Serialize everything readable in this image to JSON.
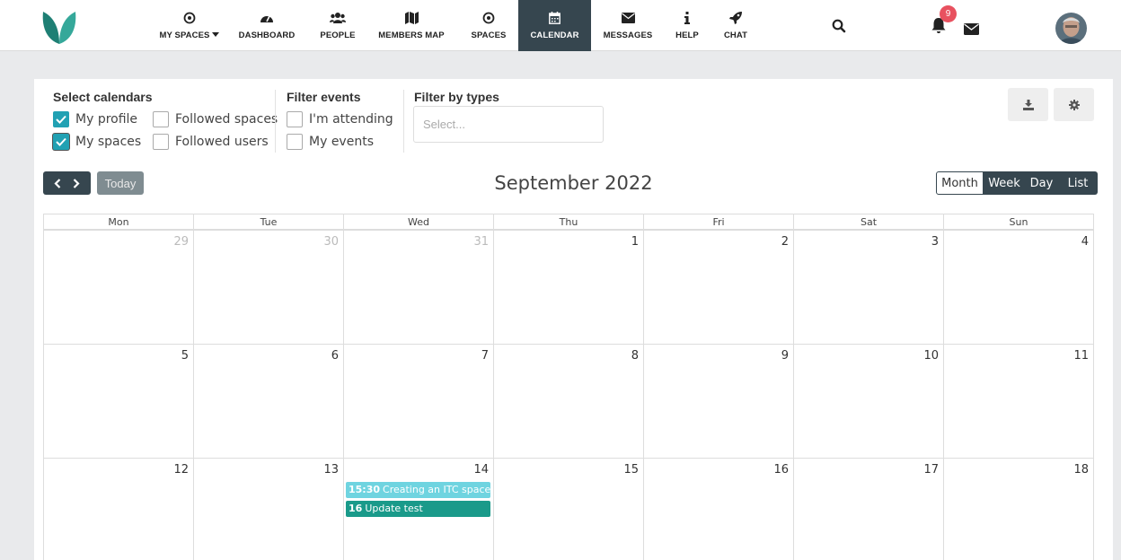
{
  "nav": {
    "items": [
      {
        "label": "MY SPACES",
        "icon": "dot-circle-icon"
      },
      {
        "label": "DASHBOARD",
        "icon": "tachometer-icon"
      },
      {
        "label": "PEOPLE",
        "icon": "users-icon"
      },
      {
        "label": "MEMBERS MAP",
        "icon": "map-icon"
      },
      {
        "label": "SPACES",
        "icon": "dot-circle-icon"
      },
      {
        "label": "CALENDAR",
        "icon": "calendar-icon"
      },
      {
        "label": "MESSAGES",
        "icon": "envelope-icon"
      },
      {
        "label": "HELP",
        "icon": "info-icon"
      },
      {
        "label": "CHAT",
        "icon": "rocket-icon"
      }
    ],
    "active": "CALENDAR",
    "notification_count": "9"
  },
  "filters": {
    "select_calendars_title": "Select calendars",
    "my_profile": "My profile",
    "followed_spaces": "Followed spaces",
    "my_spaces": "My spaces",
    "followed_users": "Followed users",
    "filter_events_title": "Filter events",
    "attending": "I'm attending",
    "my_events": "My events",
    "filter_types_title": "Filter by types",
    "types_placeholder": "Select..."
  },
  "toolbar": {
    "today": "Today",
    "title": "September 2022",
    "views": [
      "Month",
      "Week",
      "Day",
      "List"
    ],
    "active_view": "Month"
  },
  "calendar": {
    "weekdays": [
      "Mon",
      "Tue",
      "Wed",
      "Thu",
      "Fri",
      "Sat",
      "Sun"
    ],
    "weeks": [
      [
        "29",
        "30",
        "31",
        "1",
        "2",
        "3",
        "4"
      ],
      [
        "5",
        "6",
        "7",
        "8",
        "9",
        "10",
        "11"
      ],
      [
        "12",
        "13",
        "14",
        "15",
        "16",
        "17",
        "18"
      ]
    ],
    "events": [
      {
        "time": "15:30",
        "title": "Creating an ITC space o",
        "color": "#6fd4e0"
      },
      {
        "time": "16",
        "title": "Update test",
        "color": "#1a9a8a"
      }
    ]
  },
  "colors": {
    "accent": "#21a1b3",
    "dark": "#36464f",
    "badge": "#e8515f"
  }
}
